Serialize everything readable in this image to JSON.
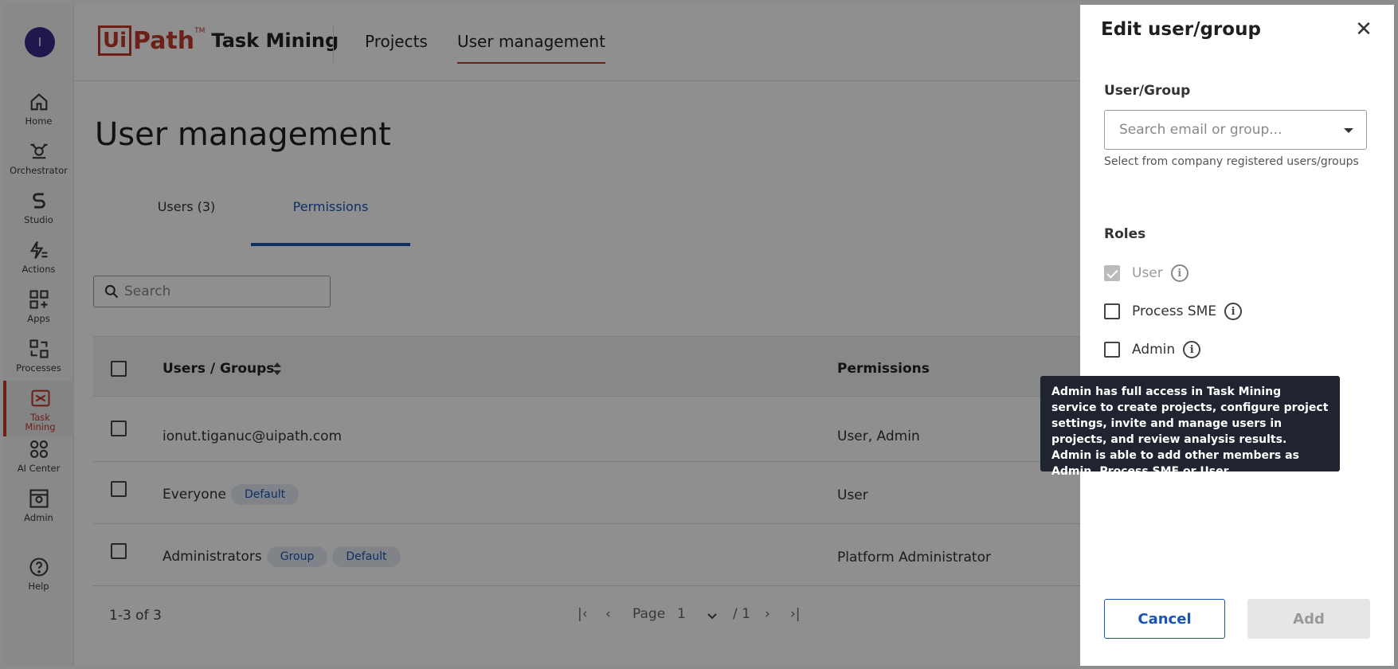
{
  "rail": {
    "avatar_initial": "I",
    "items": [
      {
        "label": "Home",
        "icon": "home-icon"
      },
      {
        "label": "Orchestrator",
        "icon": "orchestrator-icon"
      },
      {
        "label": "Studio",
        "icon": "studio-icon"
      },
      {
        "label": "Actions",
        "icon": "actions-icon"
      },
      {
        "label": "Apps",
        "icon": "apps-icon"
      },
      {
        "label": "Processes",
        "icon": "processes-icon"
      },
      {
        "label": "Task Mining",
        "icon": "task-mining-icon",
        "active": true
      },
      {
        "label": "AI Center",
        "icon": "ai-center-icon"
      },
      {
        "label": "Admin",
        "icon": "admin-icon"
      },
      {
        "label": "Help",
        "icon": "help-icon"
      }
    ]
  },
  "header": {
    "logo_ui": "Ui",
    "logo_path": "Path",
    "logo_tm": "TM",
    "product": "Task Mining",
    "nav": [
      "Projects",
      "User management"
    ],
    "accent_color": "#c0392b"
  },
  "main": {
    "title": "User management",
    "tabs": [
      "Users (3)",
      "Permissions"
    ],
    "search_placeholder": "Search",
    "table": {
      "headers": [
        "Users / Groups",
        "Permissions"
      ],
      "rows": [
        {
          "name": "ionut.tiganuc@uipath.com",
          "chips": [],
          "permissions": "User, Admin"
        },
        {
          "name": "Everyone",
          "chips": [
            "Default"
          ],
          "permissions": "User"
        },
        {
          "name": "Administrators",
          "chips": [
            "Group",
            "Default"
          ],
          "permissions": "Platform Administrator"
        }
      ]
    },
    "footer": {
      "count": "1-3 of 3",
      "page_label": "Page",
      "page_value": "1",
      "page_total": "/ 1"
    }
  },
  "panel": {
    "title": "Edit user/group",
    "user_group_label": "User/Group",
    "search_placeholder": "Search email or group...",
    "helper": "Select from company registered users/groups",
    "roles_label": "Roles",
    "roles": [
      {
        "label": "User",
        "checked": true,
        "disabled": true
      },
      {
        "label": "Process SME",
        "checked": false,
        "disabled": false
      },
      {
        "label": "Admin",
        "checked": false,
        "disabled": false
      }
    ],
    "cancel_label": "Cancel",
    "add_label": "Add",
    "tooltip": "Admin has full access in Task Mining service to create projects, configure project settings, invite and manage users in projects, and review analysis results. Admin is able to add other members as Admin, Process SME or User."
  }
}
